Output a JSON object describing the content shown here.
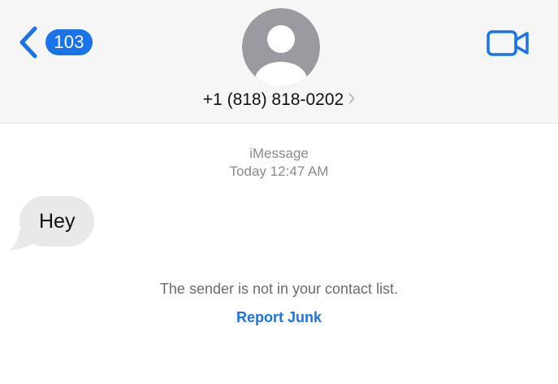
{
  "header": {
    "back_icon": "chevron-left-icon",
    "unread_count": "103",
    "avatar_icon": "person-silhouette-icon",
    "contact": "+1 (818) 818-0202",
    "contact_chevron_icon": "chevron-right-icon",
    "video_icon": "video-camera-icon"
  },
  "conversation": {
    "service": "iMessage",
    "timestamp": "Today 12:47 AM",
    "messages": [
      {
        "direction": "incoming",
        "text": "Hey"
      }
    ],
    "notice": "The sender is not in your contact list.",
    "report_junk_label": "Report Junk"
  },
  "colors": {
    "accent": "#1a73e8",
    "header_bg": "#f6f6f6",
    "incoming_bubble": "#e9e9eb",
    "secondary_text": "#8a8a8e",
    "avatar_bg": "#9a9ba0"
  }
}
